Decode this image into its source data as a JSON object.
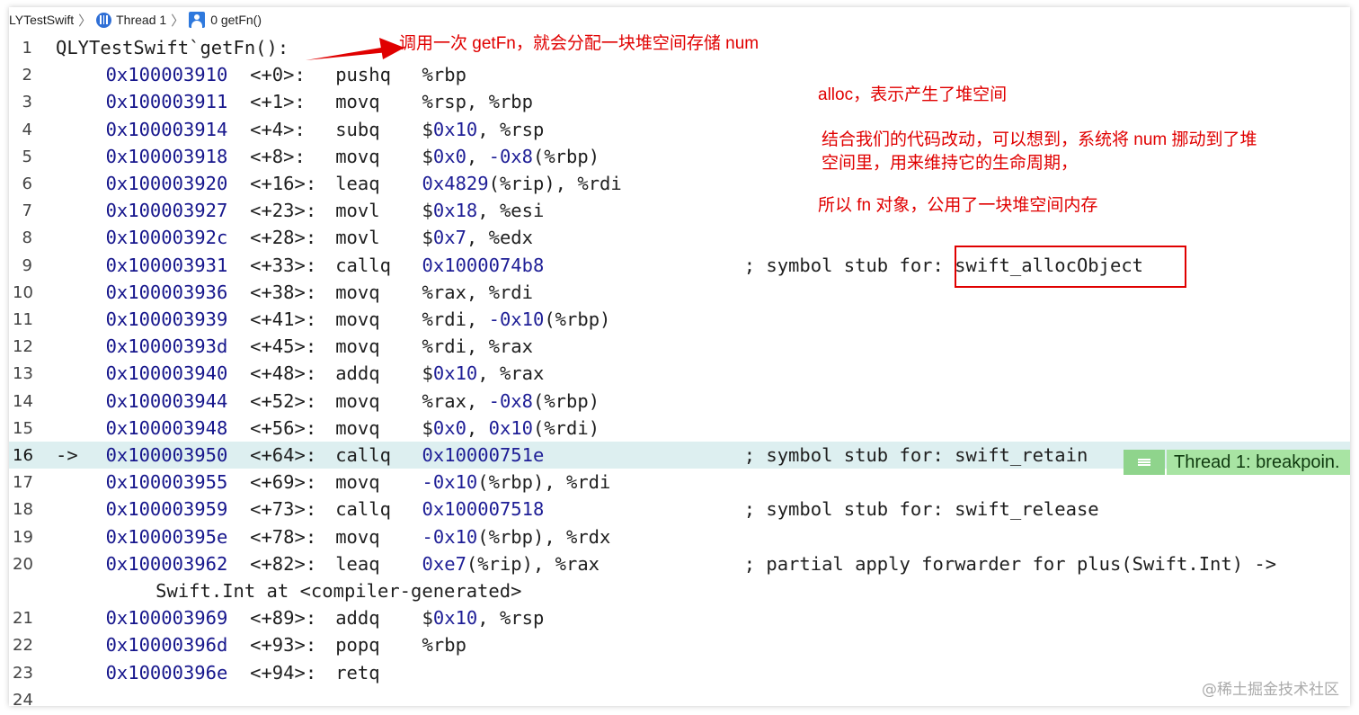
{
  "breadcrumb": {
    "project": "LYTestSwift",
    "thread": "Thread 1",
    "frame": "0 getFn()"
  },
  "lines": [
    {
      "n": "1",
      "label": "QLYTestSwift`getFn():"
    },
    {
      "n": "2",
      "addr": "0x100003910",
      "off": "<+0>:",
      "op": "pushq",
      "args": "%rbp"
    },
    {
      "n": "3",
      "addr": "0x100003911",
      "off": "<+1>:",
      "op": "movq",
      "args": "%rsp, %rbp"
    },
    {
      "n": "4",
      "addr": "0x100003914",
      "off": "<+4>:",
      "op": "subq",
      "args": "$0x10, %rsp"
    },
    {
      "n": "5",
      "addr": "0x100003918",
      "off": "<+8>:",
      "op": "movq",
      "args": "$0x0, -0x8(%rbp)"
    },
    {
      "n": "6",
      "addr": "0x100003920",
      "off": "<+16>:",
      "op": "leaq",
      "args": "0x4829(%rip), %rdi"
    },
    {
      "n": "7",
      "addr": "0x100003927",
      "off": "<+23>:",
      "op": "movl",
      "args": "$0x18, %esi"
    },
    {
      "n": "8",
      "addr": "0x10000392c",
      "off": "<+28>:",
      "op": "movl",
      "args": "$0x7, %edx"
    },
    {
      "n": "9",
      "addr": "0x100003931",
      "off": "<+33>:",
      "op": "callq",
      "args": "0x1000074b8",
      "comment": "; symbol stub for: swift_allocObject"
    },
    {
      "n": "10",
      "addr": "0x100003936",
      "off": "<+38>:",
      "op": "movq",
      "args": "%rax, %rdi"
    },
    {
      "n": "11",
      "addr": "0x100003939",
      "off": "<+41>:",
      "op": "movq",
      "args": "%rdi, -0x10(%rbp)"
    },
    {
      "n": "12",
      "addr": "0x10000393d",
      "off": "<+45>:",
      "op": "movq",
      "args": "%rdi, %rax"
    },
    {
      "n": "13",
      "addr": "0x100003940",
      "off": "<+48>:",
      "op": "addq",
      "args": "$0x10, %rax"
    },
    {
      "n": "14",
      "addr": "0x100003944",
      "off": "<+52>:",
      "op": "movq",
      "args": "%rax, -0x8(%rbp)"
    },
    {
      "n": "15",
      "addr": "0x100003948",
      "off": "<+56>:",
      "op": "movq",
      "args": "$0x0, 0x10(%rdi)"
    },
    {
      "n": "16",
      "arrow": "->",
      "addr": "0x100003950",
      "off": "<+64>:",
      "op": "callq",
      "args": "0x10000751e",
      "comment": "; symbol stub for: swift_retain"
    },
    {
      "n": "17",
      "addr": "0x100003955",
      "off": "<+69>:",
      "op": "movq",
      "args": "-0x10(%rbp), %rdi"
    },
    {
      "n": "18",
      "addr": "0x100003959",
      "off": "<+73>:",
      "op": "callq",
      "args": "0x100007518",
      "comment": "; symbol stub for: swift_release"
    },
    {
      "n": "19",
      "addr": "0x10000395e",
      "off": "<+78>:",
      "op": "movq",
      "args": "-0x10(%rbp), %rdx"
    },
    {
      "n": "20",
      "addr": "0x100003962",
      "off": "<+82>:",
      "op": "leaq",
      "args": "0xe7(%rip), %rax",
      "comment": "; partial apply forwarder for plus(Swift.Int) ->"
    },
    {
      "n": "",
      "cont": "Swift.Int at <compiler-generated>"
    },
    {
      "n": "21",
      "addr": "0x100003969",
      "off": "<+89>:",
      "op": "addq",
      "args": "$0x10, %rsp"
    },
    {
      "n": "22",
      "addr": "0x10000396d",
      "off": "<+93>:",
      "op": "popq",
      "args": "%rbp"
    },
    {
      "n": "23",
      "addr": "0x10000396e",
      "off": "<+94>:",
      "op": "retq",
      "args": ""
    },
    {
      "n": "24",
      "addr": "",
      "off": "",
      "op": "",
      "args": ""
    }
  ],
  "annotations": {
    "top_note": "调用一次 getFn，就会分配一块堆空间存储 num",
    "alloc_note": "alloc，表示产生了堆空间",
    "move_note_1": "结合我们的代码改动，可以想到，系统将 num 挪动到了堆",
    "move_note_2": "空间里，用来维持它的生命周期，",
    "share_note": "所以 fn 对象，公用了一块堆空间内存"
  },
  "breakpoint": {
    "label": "Thread 1: breakpoin."
  },
  "watermark": "@稀土掘金技术社区",
  "colors": {
    "annotation": "#e00000",
    "current_line": "#ddeff0",
    "breakpoint": "#a8e4a3",
    "address": "#16168c"
  }
}
